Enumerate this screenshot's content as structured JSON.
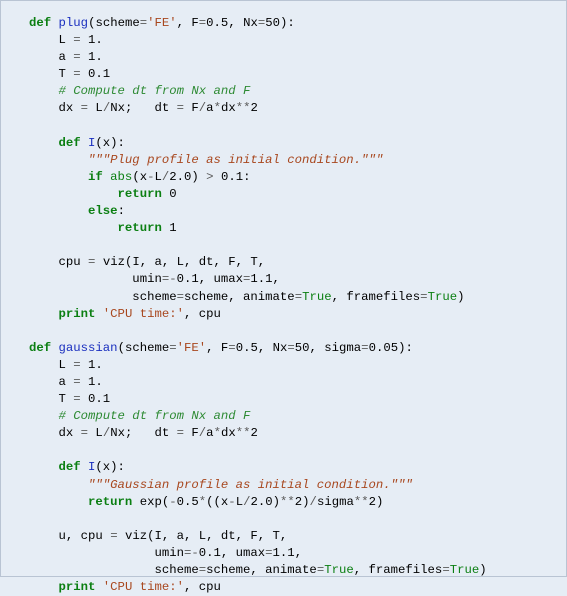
{
  "func1": {
    "def": "def",
    "name": "plug",
    "sig_open": "(scheme",
    "eq1": "=",
    "s_fe": "'FE'",
    "c1": ", F",
    "eq2": "=",
    "v05": "0.5",
    "c2": ", Nx",
    "eq3": "=",
    "v50": "50",
    "close": "):",
    "l_L": "    L ",
    "eq_L": "=",
    "v_L": " 1.",
    "l_a": "    a ",
    "eq_a": "=",
    "v_a": " 1.",
    "l_T": "    T ",
    "eq_T": "=",
    "v_T": " 0.1",
    "cmt": "    # Compute dt from Nx and F",
    "dx_pre": "    dx ",
    "dx_eq": "=",
    "dx_mid": " L",
    "dx_sl": "/",
    "dx_nx": "Nx;   dt ",
    "dt_eq": "=",
    "dt_mid": " F",
    "dt_sl": "/",
    "dt_rest": "a",
    "dt_star": "*",
    "dt_dx": "dx",
    "dt_pow": "**",
    "dt_2": "2",
    "inner_def": "    def",
    "inner_name": " I",
    "inner_sig": "(x):",
    "doc": "        \"\"\"Plug profile as initial condition.\"\"\"",
    "if_kw": "        if",
    "if_abs": " abs",
    "if_body": "(x",
    "if_minus": "-",
    "if_L": "L",
    "if_sl": "/",
    "if_2": "2.0",
    "if_cp": ") ",
    "if_gt": ">",
    "if_01": " 0.1:",
    "ret1_kw": "            return",
    "ret1_v": " 0",
    "else_kw": "        else",
    "else_c": ":",
    "ret2_kw": "            return",
    "ret2_v": " 1",
    "cpu_pre": "    cpu ",
    "cpu_eq": "=",
    "cpu_viz": " viz(I, a, L, dt, F, T,",
    "cpu_l2": "              umin",
    "cpu_eq2": "=-",
    "cpu_v2": "0.1",
    "cpu_c2": ", umax",
    "cpu_eq3": "=",
    "cpu_v3": "1.1",
    "cpu_c3": ",",
    "cpu_l3": "              scheme",
    "cpu_eq4": "=",
    "cpu_sc": "scheme, animate",
    "cpu_eq5": "=",
    "cpu_tr1": "True",
    "cpu_c4": ", framefiles",
    "cpu_eq6": "=",
    "cpu_tr2": "True",
    "cpu_cp": ")",
    "print_kw": "    print",
    "print_str": " 'CPU time:'",
    "print_rest": ", cpu"
  },
  "func2": {
    "def": "def",
    "name": "gaussian",
    "sig_open": "(scheme",
    "eq1": "=",
    "s_fe": "'FE'",
    "c1": ", F",
    "eq2": "=",
    "v05": "0.5",
    "c2": ", Nx",
    "eq3": "=",
    "v50": "50",
    "c3": ", sigma",
    "eq4": "=",
    "vsig": "0.05",
    "close": "):",
    "l_L": "    L ",
    "eq_L": "=",
    "v_L": " 1.",
    "l_a": "    a ",
    "eq_a": "=",
    "v_a": " 1.",
    "l_T": "    T ",
    "eq_T": "=",
    "v_T": " 0.1",
    "cmt": "    # Compute dt from Nx and F",
    "dx_pre": "    dx ",
    "dx_eq": "=",
    "dx_mid": " L",
    "dx_sl": "/",
    "dx_nx": "Nx;   dt ",
    "dt_eq": "=",
    "dt_mid": " F",
    "dt_sl": "/",
    "dt_rest": "a",
    "dt_star": "*",
    "dt_dx": "dx",
    "dt_pow": "**",
    "dt_2": "2",
    "inner_def": "    def",
    "inner_name": " I",
    "inner_sig": "(x):",
    "doc": "        \"\"\"Gaussian profile as initial condition.\"\"\"",
    "ret_kw": "        return",
    "ret_exp": " exp",
    "ret_op": "(",
    "ret_neg": "-",
    "ret_05": "0.5",
    "ret_st1": "*",
    "ret_p1": "((x",
    "ret_minus": "-",
    "ret_L": "L",
    "ret_sl": "/",
    "ret_2": "2.0",
    "ret_cp1": ")",
    "ret_pow1": "**",
    "ret_22": "2",
    "ret_cp2": ")",
    "ret_sl2": "/",
    "ret_sig": "sigma",
    "ret_pow2": "**",
    "ret_23": "2",
    "ret_cp3": ")",
    "cpu_pre": "    u, cpu ",
    "cpu_eq": "=",
    "cpu_viz": " viz(I, a, L, dt, F, T,",
    "cpu_l2": "                 umin",
    "cpu_eq2": "=-",
    "cpu_v2": "0.1",
    "cpu_c2": ", umax",
    "cpu_eq3": "=",
    "cpu_v3": "1.1",
    "cpu_c3": ",",
    "cpu_l3": "                 scheme",
    "cpu_eq4": "=",
    "cpu_sc": "scheme, animate",
    "cpu_eq5": "=",
    "cpu_tr1": "True",
    "cpu_c4": ", framefiles",
    "cpu_eq6": "=",
    "cpu_tr2": "True",
    "cpu_cp": ")",
    "print_kw": "    print",
    "print_str": " 'CPU time:'",
    "print_rest": ", cpu"
  }
}
